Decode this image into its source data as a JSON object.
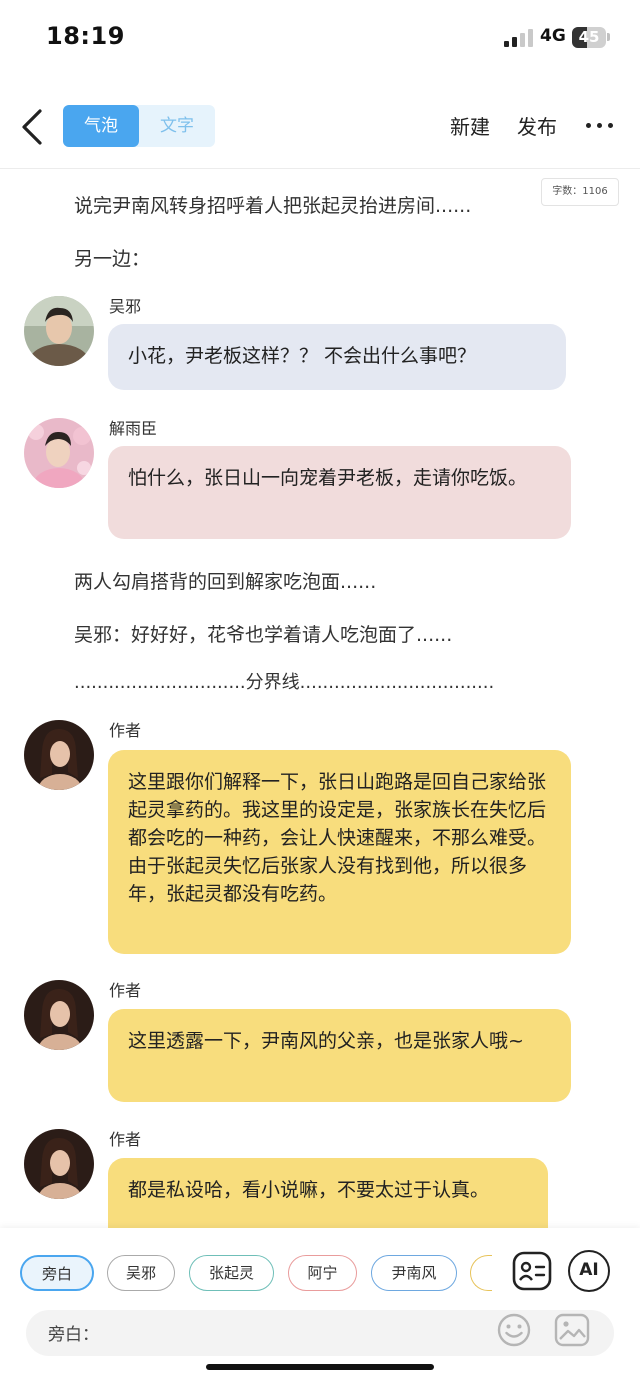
{
  "status": {
    "time": "18:19",
    "network": "4G",
    "battery": "45",
    "battery_level": 0.45
  },
  "header": {
    "tabs": [
      {
        "label": "气泡",
        "active": true
      },
      {
        "label": "文字",
        "active": false
      }
    ],
    "new_label": "新建",
    "publish_label": "发布"
  },
  "word_count": "字数：1106",
  "narration": [
    "说完尹南风转身招呼着人把张起灵抬进房间......",
    "另一边：",
    "两人勾肩搭背的回到解家吃泡面......",
    "吴邪：好好好，花爷也学着请人吃泡面了......",
    "..............................分界线.................................."
  ],
  "messages": [
    {
      "speaker": "吴邪",
      "text": "小花，尹老板这样？？ 不会出什么事吧？",
      "bubble_color": "#e4e8f2"
    },
    {
      "speaker": "解雨臣",
      "text": "怕什么，张日山一向宠着尹老板，走请你吃饭。",
      "bubble_color": "#f1dcdc"
    },
    {
      "speaker": "作者",
      "text": "这里跟你们解释一下，张日山跑路是回自己家给张起灵拿药的。我这里的设定是，张家族长在失忆后都会吃的一种药，会让人快速醒来，不那么难受。由于张起灵失忆后张家人没有找到他，所以很多年，张起灵都没有吃药。",
      "bubble_color": "#f8dd7d"
    },
    {
      "speaker": "作者",
      "text": "这里透露一下，尹南风的父亲，也是张家人哦~",
      "bubble_color": "#f8dd7d"
    },
    {
      "speaker": "作者",
      "text": "都是私设哈，看小说嘛，不要太过于认真。",
      "bubble_color": "#f8dd7d"
    }
  ],
  "characters": [
    "旁白",
    "吴邪",
    "张起灵",
    "阿宁",
    "尹南风"
  ],
  "tools": {
    "ai_label": "AI"
  },
  "input": {
    "label": "旁白："
  },
  "colors": {
    "accent": "#4aa6ef",
    "author_bubble": "#f8dd7d"
  }
}
